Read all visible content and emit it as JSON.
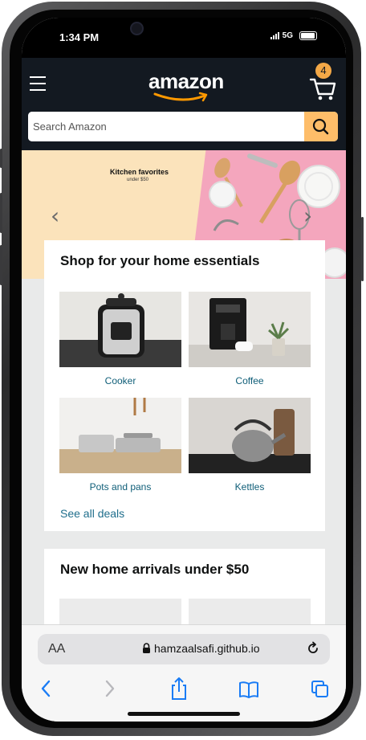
{
  "status_bar": {
    "time": "1:34 PM",
    "network": "5G"
  },
  "header": {
    "logo_text": "amazon",
    "cart_count": "4",
    "search": {
      "placeholder": "Search Amazon"
    }
  },
  "hero": {
    "title": "Kitchen favorites",
    "subtitle": "under $50"
  },
  "card_essentials": {
    "title": "Shop for your home essentials",
    "tiles": [
      {
        "label": "Cooker"
      },
      {
        "label": "Coffee"
      },
      {
        "label": "Pots and pans"
      },
      {
        "label": "Kettles"
      }
    ],
    "see_all": "See all deals"
  },
  "card_arrivals": {
    "title": "New home arrivals under $50"
  },
  "safari": {
    "text_size": "AA",
    "url": "hamzaalsafi.github.io"
  },
  "colors": {
    "header_bg": "#131921",
    "search_button": "#febd69",
    "cart_badge": "#f3a847",
    "link": "#0f5e78",
    "ios_blue": "#1a7cf5"
  }
}
